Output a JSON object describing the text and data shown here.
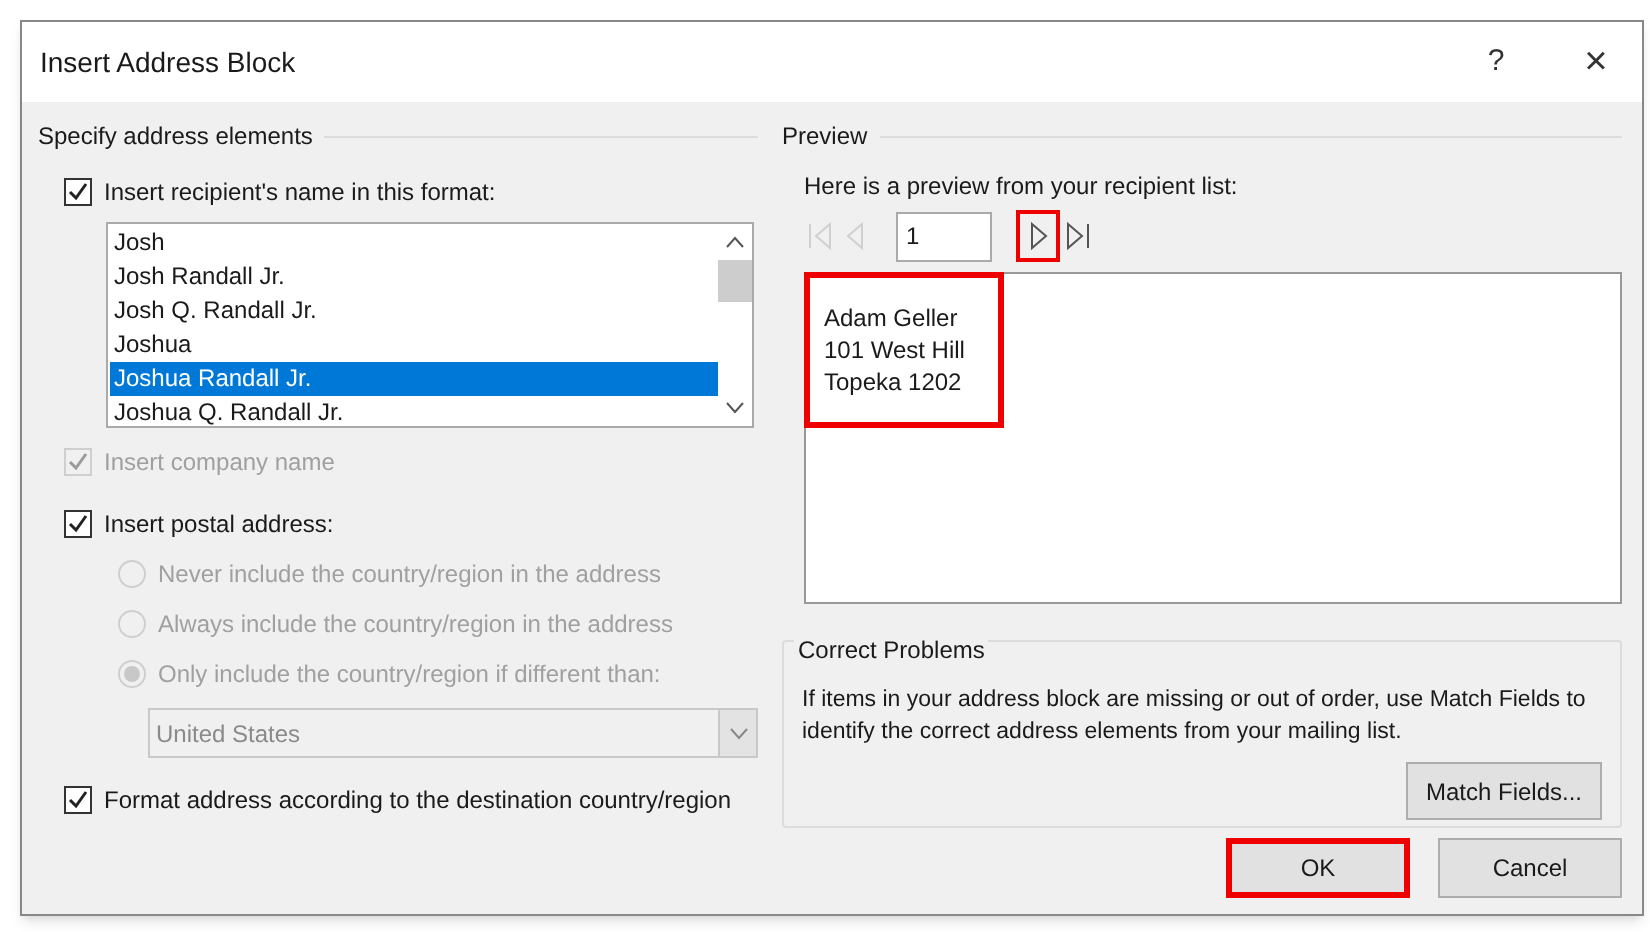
{
  "window": {
    "title": "Insert Address Block",
    "buttons": [
      {
        "kind": "help",
        "label": "?"
      },
      {
        "kind": "close",
        "label": "×"
      }
    ]
  },
  "address_elements": {
    "heading": "Specify address elements",
    "name_format": {
      "label": "Insert recipient's name in this format:",
      "checked": true,
      "options": [
        {
          "label": "Josh",
          "selected": false
        },
        {
          "label": "Josh Randall Jr.",
          "selected": false
        },
        {
          "label": "Josh Q. Randall Jr.",
          "selected": false
        },
        {
          "label": "Joshua",
          "selected": false
        },
        {
          "label": "Joshua Randall Jr.",
          "selected": true
        },
        {
          "label": "Joshua Q. Randall Jr.",
          "selected": false
        }
      ]
    },
    "company": {
      "label": "Insert company name",
      "checked": true,
      "disabled": true
    },
    "postal": {
      "label": "Insert postal address:",
      "checked": true,
      "disabled": false,
      "options": [
        {
          "label": "Never include the country/region in the address",
          "selected": false,
          "disabled": true
        },
        {
          "label": "Always include the country/region in the address",
          "selected": false,
          "disabled": true
        },
        {
          "label": "Only include the country/region if different than:",
          "selected": true,
          "disabled": true
        }
      ],
      "country": {
        "value": "United States",
        "disabled": true
      }
    },
    "format_by_country": {
      "label": "Format address according to the destination country/region",
      "checked": true,
      "disabled": false
    }
  },
  "preview": {
    "heading": "Preview",
    "intro": "Here is a preview from your recipient list:",
    "record": "1",
    "nav": [
      {
        "kind": "first",
        "disabled": true,
        "highlighted": false
      },
      {
        "kind": "previous",
        "disabled": true,
        "highlighted": false
      },
      {
        "kind": "next",
        "disabled": false,
        "highlighted": true
      },
      {
        "kind": "last",
        "disabled": false,
        "highlighted": false
      }
    ],
    "address_lines": [
      "Adam Geller",
      "101 West Hill",
      "Topeka 1202"
    ],
    "address_highlighted": true
  },
  "correct_problems": {
    "heading": "Correct Problems",
    "text": "If items in your address block are missing or out of order, use Match Fields to identify the correct address elements from your mailing list.",
    "button": "Match Fields..."
  },
  "buttons": [
    {
      "label": "OK",
      "highlighted": true
    },
    {
      "label": "Cancel",
      "highlighted": false
    }
  ]
}
